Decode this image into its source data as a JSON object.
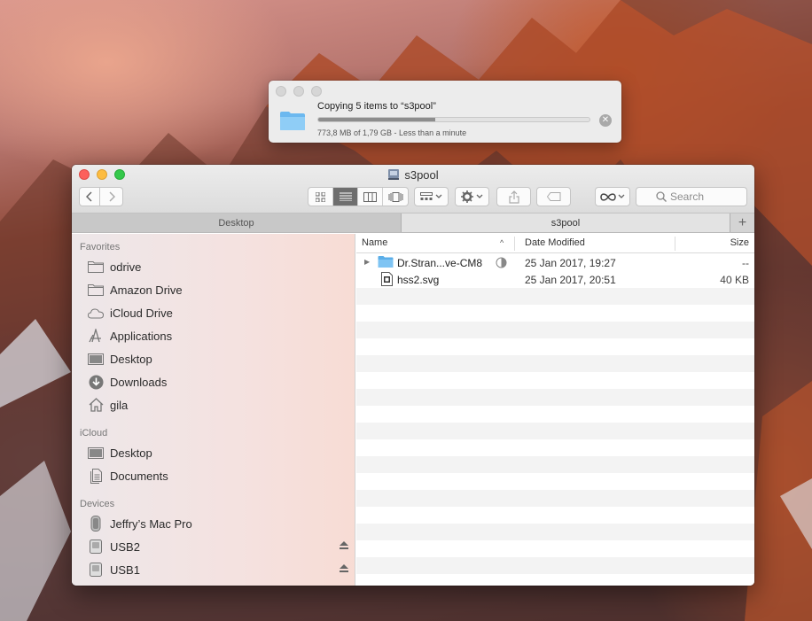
{
  "copy_dialog": {
    "title": "Copying 5 items to “s3pool”",
    "status": "773,8 MB of 1,79 GB - Less than a minute",
    "progress_fraction": 0.43
  },
  "window": {
    "title": "s3pool"
  },
  "toolbar": {
    "search_placeholder": "Search",
    "view_modes": [
      "icon-view",
      "list-view",
      "column-view",
      "cover-flow-view"
    ],
    "active_view": "list-view"
  },
  "tabs": [
    {
      "label": "Desktop"
    },
    {
      "label": "s3pool"
    }
  ],
  "tab_add_label": "+",
  "sidebar": {
    "favorites_heading": "Favorites",
    "favorites": [
      {
        "label": "odrive",
        "icon": "folder-icon"
      },
      {
        "label": "Amazon Drive",
        "icon": "folder-icon"
      },
      {
        "label": "iCloud Drive",
        "icon": "cloud-icon"
      },
      {
        "label": "Applications",
        "icon": "applications-icon"
      },
      {
        "label": "Desktop",
        "icon": "desktop-icon"
      },
      {
        "label": "Downloads",
        "icon": "downloads-icon"
      },
      {
        "label": "gila",
        "icon": "home-icon"
      }
    ],
    "icloud_heading": "iCloud",
    "icloud": [
      {
        "label": "Desktop",
        "icon": "desktop-icon"
      },
      {
        "label": "Documents",
        "icon": "documents-icon"
      }
    ],
    "devices_heading": "Devices",
    "devices": [
      {
        "label": "Jeffry’s Mac Pro",
        "icon": "computer-icon"
      },
      {
        "label": "USB2",
        "icon": "drive-icon"
      },
      {
        "label": "USB1",
        "icon": "drive-icon"
      }
    ]
  },
  "columns": {
    "name": "Name",
    "sort_indicator": "^",
    "date": "Date Modified",
    "size": "Size"
  },
  "files": [
    {
      "name": "Dr.Stran...ve-CM8",
      "date": "25 Jan 2017, 19:27",
      "size": "--",
      "kind": "folder"
    },
    {
      "name": "hss2.svg",
      "date": "25 Jan 2017, 20:51",
      "size": "40 KB",
      "kind": "file"
    }
  ]
}
